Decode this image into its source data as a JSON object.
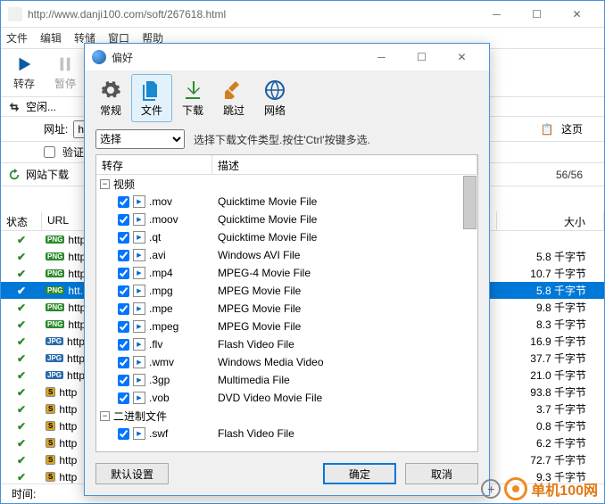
{
  "bg": {
    "url": "http://www.danji100.com/soft/267618.html",
    "menu": [
      "文件",
      "编辑",
      "转储",
      "窗口",
      "帮助"
    ],
    "toolbar": {
      "save": "转存",
      "pause": "暂停"
    },
    "status_idle": "空闲...",
    "addr_label": "网址:",
    "addr_scheme": "http://",
    "verify_label": "验证",
    "page_label": "这页",
    "tabs_label": "网站下载",
    "count": "56/56",
    "headers": {
      "status": "状态",
      "url": "URL",
      "size": "大小"
    },
    "rows": [
      {
        "type": "png",
        "url": "http",
        "size": ""
      },
      {
        "type": "png",
        "url": "http",
        "size": "5.8 千字节"
      },
      {
        "type": "png",
        "url": "http",
        "size": "10.7 千字节"
      },
      {
        "type": "png",
        "url": "htt...",
        "size": "5.8 千字节",
        "sel": true
      },
      {
        "type": "png",
        "url": "http",
        "size": "9.8 千字节"
      },
      {
        "type": "png",
        "url": "http",
        "size": "8.3 千字节"
      },
      {
        "type": "jpg",
        "url": "http",
        "size": "16.9 千字节"
      },
      {
        "type": "jpg",
        "url": "http",
        "size": "37.7 千字节"
      },
      {
        "type": "jpg",
        "url": "http",
        "size": "21.0 千字节"
      },
      {
        "type": "s",
        "url": "http",
        "size": "93.8 千字节"
      },
      {
        "type": "s",
        "url": "http",
        "size": "3.7 千字节"
      },
      {
        "type": "s",
        "url": "http",
        "size": "0.8 千字节"
      },
      {
        "type": "s",
        "url": "http",
        "size": "6.2 千字节"
      },
      {
        "type": "s",
        "url": "http",
        "size": "72.7 千字节"
      },
      {
        "type": "s",
        "url": "http",
        "size": "9.3 千字节"
      }
    ],
    "footer_time": "时间:"
  },
  "dialog": {
    "title": "偏好",
    "tabs": {
      "general": "常规",
      "file": "文件",
      "download": "下载",
      "skip": "跳过",
      "network": "网络"
    },
    "filter_select": "选择",
    "filter_hint": "选择下载文件类型.按住'Ctrl'按键多选.",
    "list_headers": {
      "ext": "转存",
      "desc": "描述"
    },
    "groups": [
      {
        "name": "视频",
        "items": [
          {
            "ext": ".mov",
            "desc": "Quicktime Movie File"
          },
          {
            "ext": ".moov",
            "desc": "Quicktime Movie File"
          },
          {
            "ext": ".qt",
            "desc": "Quicktime Movie File"
          },
          {
            "ext": ".avi",
            "desc": "Windows AVI File"
          },
          {
            "ext": ".mp4",
            "desc": "MPEG-4 Movie File"
          },
          {
            "ext": ".mpg",
            "desc": "MPEG Movie File"
          },
          {
            "ext": ".mpe",
            "desc": "MPEG Movie File"
          },
          {
            "ext": ".mpeg",
            "desc": "MPEG Movie File"
          },
          {
            "ext": ".flv",
            "desc": "Flash Video File"
          },
          {
            "ext": ".wmv",
            "desc": "Windows Media Video"
          },
          {
            "ext": ".3gp",
            "desc": "Multimedia File"
          },
          {
            "ext": ".vob",
            "desc": "DVD Video Movie File"
          }
        ]
      },
      {
        "name": "二进制文件",
        "items": [
          {
            "ext": ".swf",
            "desc": "Flash Video File"
          }
        ]
      }
    ],
    "buttons": {
      "defaults": "默认设置",
      "ok": "确定",
      "cancel": "取消"
    }
  },
  "watermark": "单机100网"
}
